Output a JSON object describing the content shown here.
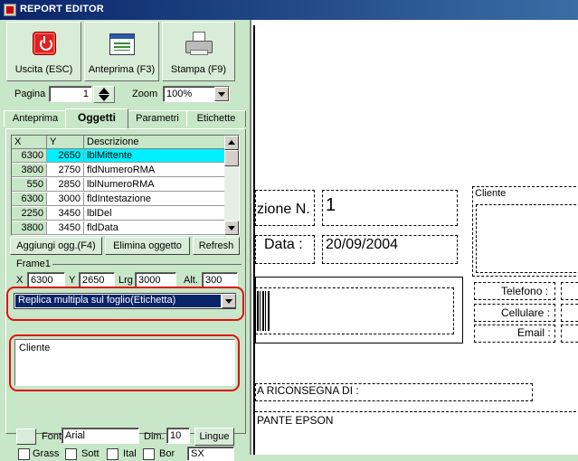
{
  "window": {
    "title": "REPORT EDITOR"
  },
  "toolbar": {
    "exit_label": "Uscita (ESC)",
    "preview_label": "Anteprima (F3)",
    "print_label": "Stampa (F9)"
  },
  "page_controls": {
    "page_label": "Pagina",
    "page_value": "1",
    "zoom_label": "Zoom",
    "zoom_value": "100%"
  },
  "tabs": [
    "Anteprima",
    "Oggetti",
    "Parametri",
    "Etichette"
  ],
  "active_tab": "Oggetti",
  "objects_grid": {
    "columns": [
      "X",
      "Y",
      "Descrizione"
    ],
    "rows": [
      {
        "x": "6300",
        "y": "2650",
        "desc": "lblMittente",
        "selected": true
      },
      {
        "x": "3800",
        "y": "2750",
        "desc": "fldNumeroRMA"
      },
      {
        "x": "550",
        "y": "2850",
        "desc": "lblNumeroRMA"
      },
      {
        "x": "6300",
        "y": "3000",
        "desc": "fldIntestazione"
      },
      {
        "x": "2250",
        "y": "3450",
        "desc": "lblDel"
      },
      {
        "x": "3800",
        "y": "3450",
        "desc": "fldData"
      }
    ]
  },
  "object_buttons": {
    "add": "Aggiungi ogg.(F4)",
    "delete": "Elimina oggetto",
    "refresh": "Refresh"
  },
  "frame": {
    "name": "Frame1",
    "x_label": "X",
    "x_value": "6300",
    "y_label": "Y",
    "y_value": "2650",
    "lrg_label": "Lrg",
    "lrg_value": "3000",
    "alt_label": "Alt.",
    "alt_value": "300",
    "mode_value": "Replica multipla sul foglio(Etichetta)",
    "text_value": "Cliente"
  },
  "font_row": {
    "font_label": "Font",
    "font_value": "Arial",
    "dim_label": "Dim.",
    "dim_value": "10",
    "lingue_label": "Lingue"
  },
  "style_row": {
    "grass_label": "Grass",
    "sott_label": "Sott",
    "ital_label": "Ital",
    "bor_label": "Bor",
    "align_value": "SX"
  },
  "report_canvas": {
    "numero_label": "zione N.",
    "numero_value": "1",
    "data_label": "Data :",
    "data_value": "20/09/2004",
    "cliente_label": "Cliente",
    "telefono_label": "Telefono :",
    "cellulare_label": "Cellulare :",
    "email_label": "Email :",
    "riconsegna_text": "A RICONSEGNA DI :",
    "epson_text": "PANTE EPSON"
  },
  "colors": {
    "panel": "#c8e6c8",
    "selected_row": "#00f0ff",
    "highlight_ring": "#e01010",
    "title_bar": "#0a246a"
  }
}
